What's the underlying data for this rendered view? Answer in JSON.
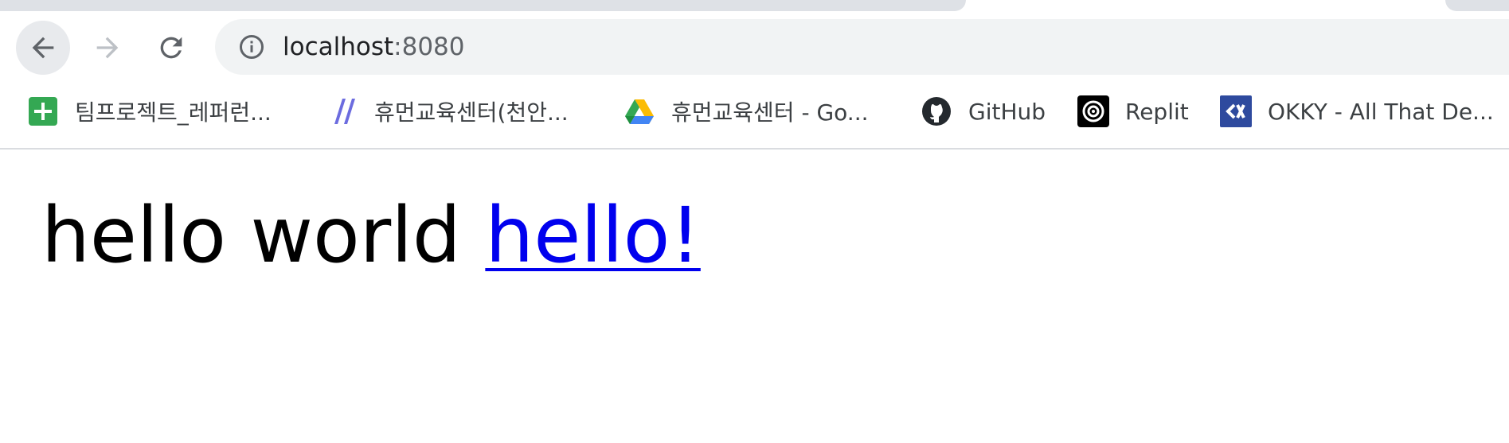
{
  "browser": {
    "address_bar": {
      "host": "localhost",
      "port": ":8080"
    },
    "bookmarks": [
      {
        "label": "팀프로젝트_레퍼런...",
        "icon": "green-plus-sheet-icon"
      },
      {
        "label": "휴먼교육센터(천안...",
        "icon": "purple-slashes-icon"
      },
      {
        "label": "휴먼교육센터 - Go...",
        "icon": "google-drive-icon"
      },
      {
        "label": "GitHub",
        "icon": "github-icon"
      },
      {
        "label": "Replit",
        "icon": "replit-icon"
      },
      {
        "label": "OKKY - All That De...",
        "icon": "okky-icon"
      }
    ]
  },
  "page": {
    "text": "hello world",
    "link": "hello!"
  },
  "colors": {
    "link": "#0000ee",
    "text": "#000000",
    "omnibox_bg": "#f1f3f4"
  }
}
